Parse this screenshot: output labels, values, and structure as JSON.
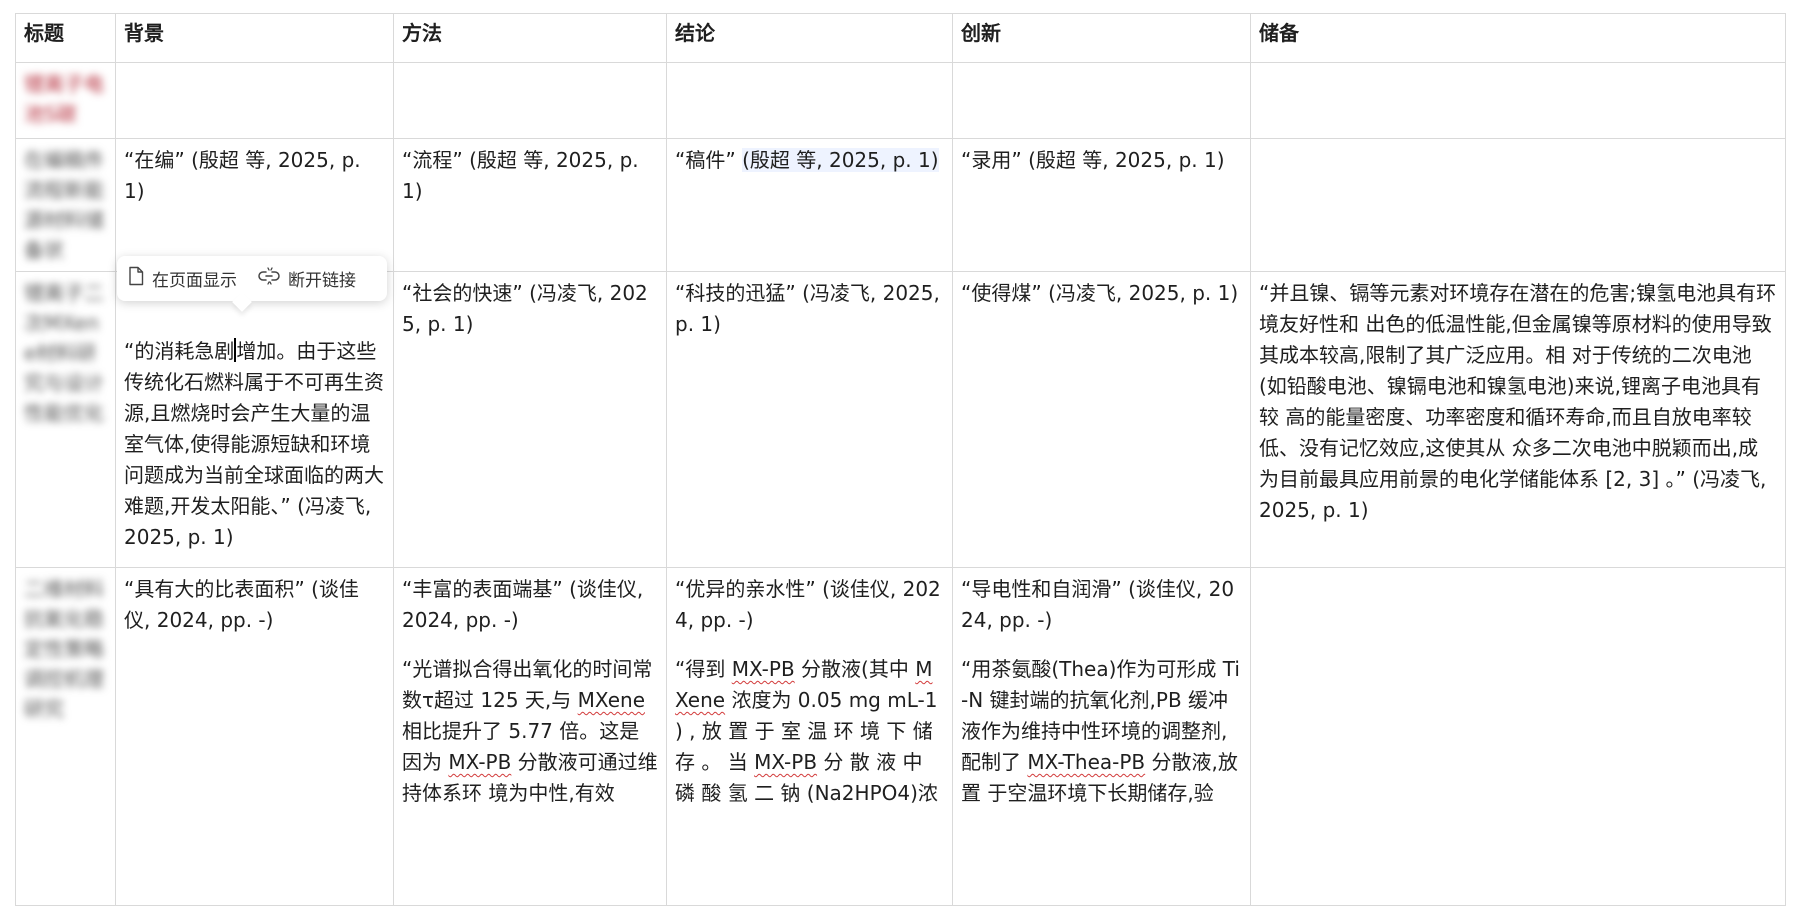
{
  "headers": [
    "标题",
    "背景",
    "方法",
    "结论",
    "创新",
    "储备"
  ],
  "rows": [
    {
      "title": "锂离子电池S碳",
      "background": "",
      "method": "",
      "conclusion": "",
      "innovation": "",
      "reserve": ""
    },
    {
      "title": "在编稿件流程新能源材料储备状",
      "background": "“在编” (殷超 等, 2025, p. 1)",
      "method": "“流程” (殷超 等, 2025, p. 1)",
      "conclusion_pre": "“稿件” ",
      "conclusion_hl": "(殷超 等, 2025, p. 1)",
      "innovation": "“录用” (殷超 等, 2025, p. 1)",
      "reserve": ""
    },
    {
      "title": "锂离子二次MXene材料研究与设计性能优化",
      "background_a": "“的消耗急剧",
      "background_b": "增加。由于这些传统化石燃料属于不可再生资源,且燃烧时会产生大量的温室气体,使得能源短缺和环境问题成为当前全球面临的两大难题,开发太阳能、” (冯凌飞, 2025, p. 1)",
      "method": "“社会的快速” (冯凌飞, 2025, p. 1)",
      "conclusion": "“科技的迅猛” (冯凌飞, 2025, p. 1)",
      "innovation": "“使得煤” (冯凌飞, 2025, p. 1)",
      "reserve": "“并且镍、镉等元素对环境存在潜在的危害;镍氢电池具有环境友好性和 出色的低温性能,但金属镍等原材料的使用导致其成本较高,限制了其广泛应用。相 对于传统的二次电池(如铅酸电池、镍镉电池和镍氢电池)来说,锂离子电池具有较 高的能量密度、功率密度和循环寿命,而且自放电率较低、没有记忆效应,这使其从 众多二次电池中脱颖而出,成为目前最具应用前景的电化学储能体系 [2, 3] 。” (冯凌飞, 2025, p. 1)"
    },
    {
      "title": "二维材料抗氧化稳定性策略调控机理研究",
      "background": "“具有大的比表面积” (谈佳仪, 2024, pp. -)",
      "method_1": "“丰富的表面端基” (谈佳仪, 2024, pp. -)",
      "method_2a": "“光谱拟合得出氧化的时间常数τ超过 125 天,与 ",
      "method_2b": "MXene",
      "method_2c": " 相比提升了 5.77 倍。这是因为 ",
      "method_2d": "MX-PB",
      "method_2e": " 分散液可通过维持体系环 境为中性,有效",
      "conclusion_1": "“优异的亲水性” (谈佳仪, 2024, pp. -)",
      "conclusion_2a": "“得到 ",
      "conclusion_2b": "MX-PB",
      "conclusion_2c": " 分散液(其中 ",
      "conclusion_2d": "MXene",
      "conclusion_2e": " 浓度为 0.05 mg mL-1 ) , 放 置 于 室 温 环 境 下 储 存 。 当 ",
      "conclusion_2f": "MX-PB",
      "conclusion_2g": " 分 散 液 中 磷 酸 氢 二 钠 (Na2HPO4)浓",
      "innovation_1": "“导电性和自润滑” (谈佳仪, 2024, pp. -)",
      "innovation_2a": "“用茶氨酸(Thea)作为可形成 Ti-N 键封端的抗氧化剂,PB 缓冲液作为维持中性环境的调整剂,配制了 ",
      "innovation_2b": "MX-Thea-PB",
      "innovation_2c": " 分散液,放置 于空温环境下长期储存,验",
      "reserve": ""
    }
  ],
  "tooltip": {
    "show_on_page": "在页面显示",
    "unlink": "断开链接",
    "show_icon": "page-icon",
    "unlink_icon": "unlink-icon"
  },
  "colors": {
    "border": "#d9d9d9",
    "highlight": "#eef3ff",
    "spell_underline": "#d23b3b"
  }
}
